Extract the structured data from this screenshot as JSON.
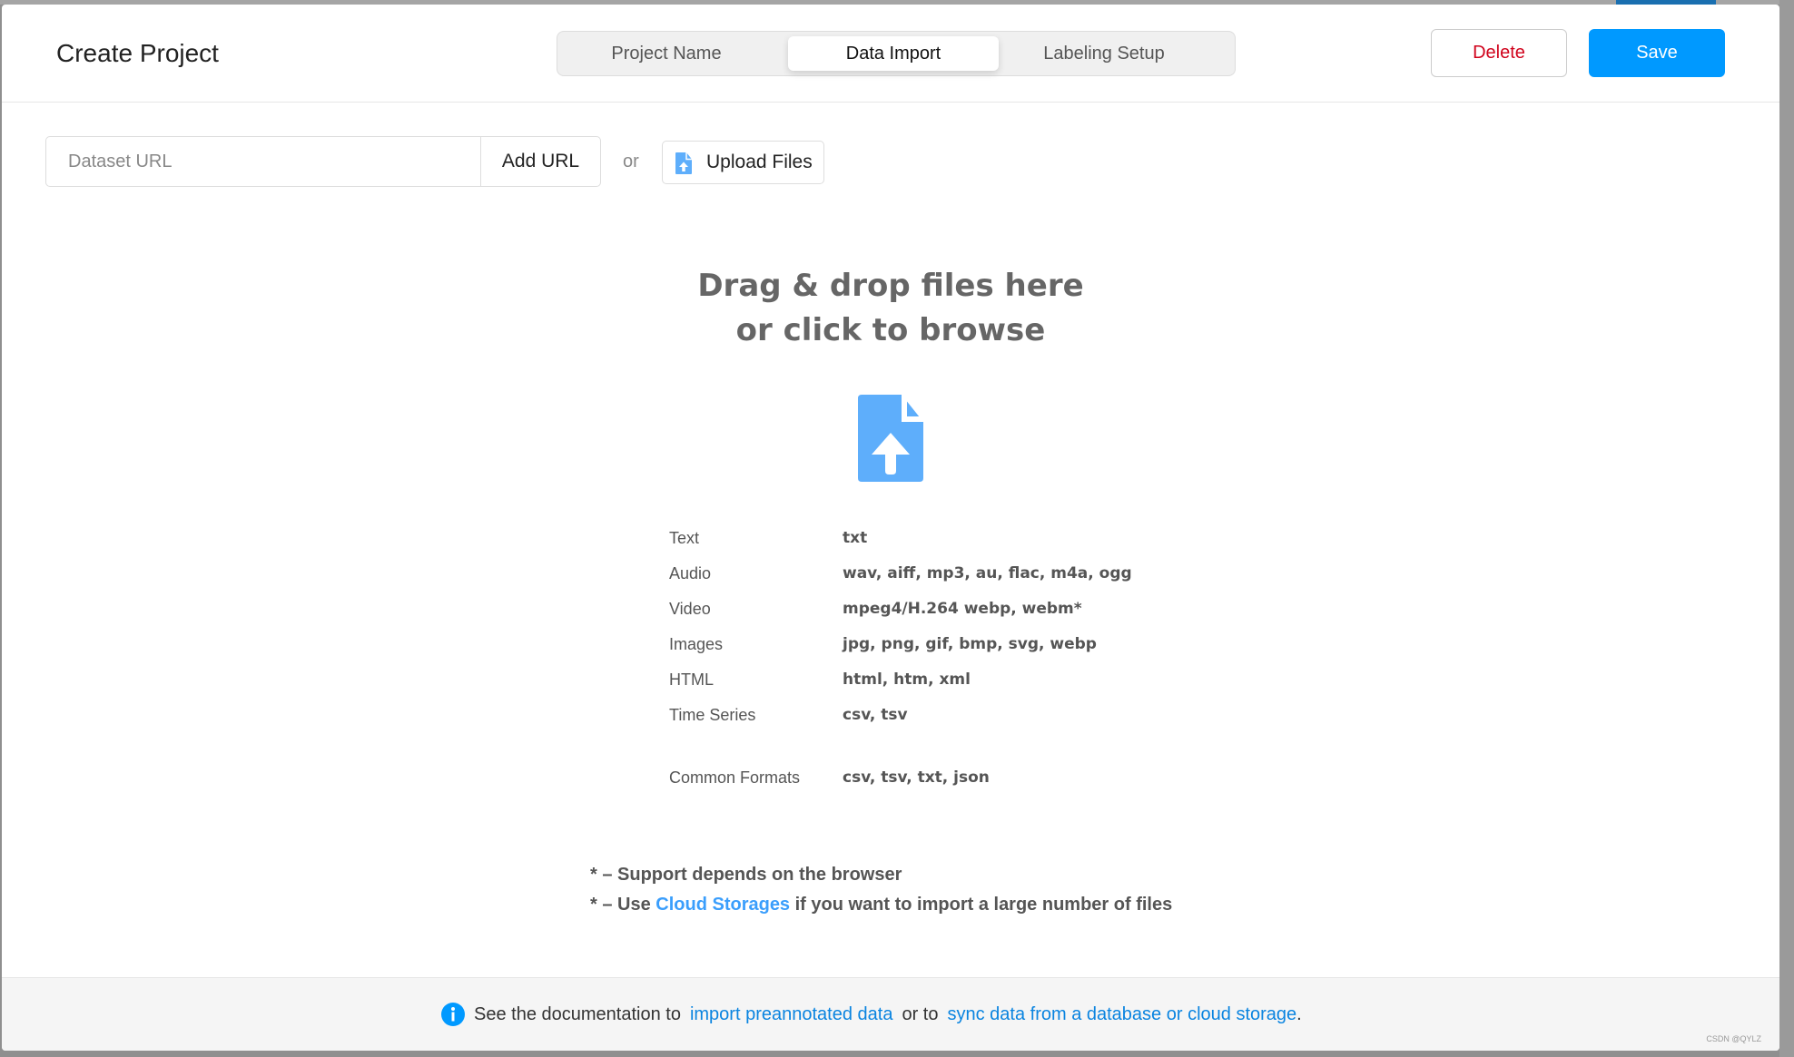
{
  "header": {
    "title": "Create Project",
    "tabs": [
      {
        "label": "Project Name"
      },
      {
        "label": "Data Import",
        "active": true
      },
      {
        "label": "Labeling Setup"
      }
    ],
    "delete_label": "Delete",
    "save_label": "Save"
  },
  "import": {
    "url_placeholder": "Dataset URL",
    "add_url_label": "Add URL",
    "or_label": "or",
    "upload_label": "Upload Files"
  },
  "dropzone": {
    "line1": "Drag & drop files here",
    "line2": "or click to browse",
    "icon": "file-upload-icon"
  },
  "formats": [
    {
      "label": "Text",
      "value": "txt"
    },
    {
      "label": "Audio",
      "value": "wav, aiff, mp3, au, flac, m4a, ogg"
    },
    {
      "label": "Video",
      "value": "mpeg4/H.264 webp, webm*"
    },
    {
      "label": "Images",
      "value": "jpg, png, gif, bmp, svg, webp"
    },
    {
      "label": "HTML",
      "value": "html, htm, xml"
    },
    {
      "label": "Time Series",
      "value": "csv, tsv"
    },
    {
      "label": "Common Formats",
      "value": "csv, tsv, txt, json"
    }
  ],
  "notes": {
    "note1": "* – Support depends on the browser",
    "note2_prefix": "* – Use ",
    "note2_link": "Cloud Storages",
    "note2_suffix": " if you want to import a large number of files"
  },
  "footer": {
    "prefix": "See the documentation to",
    "link1": "import preannotated data",
    "middle": "or to",
    "link2": "sync data from a database or cloud storage",
    "suffix": "."
  },
  "watermark": "CSDN @QYLZ",
  "colors": {
    "accent": "#0099ff",
    "danger": "#d0021b",
    "icon": "#5eaefb"
  }
}
